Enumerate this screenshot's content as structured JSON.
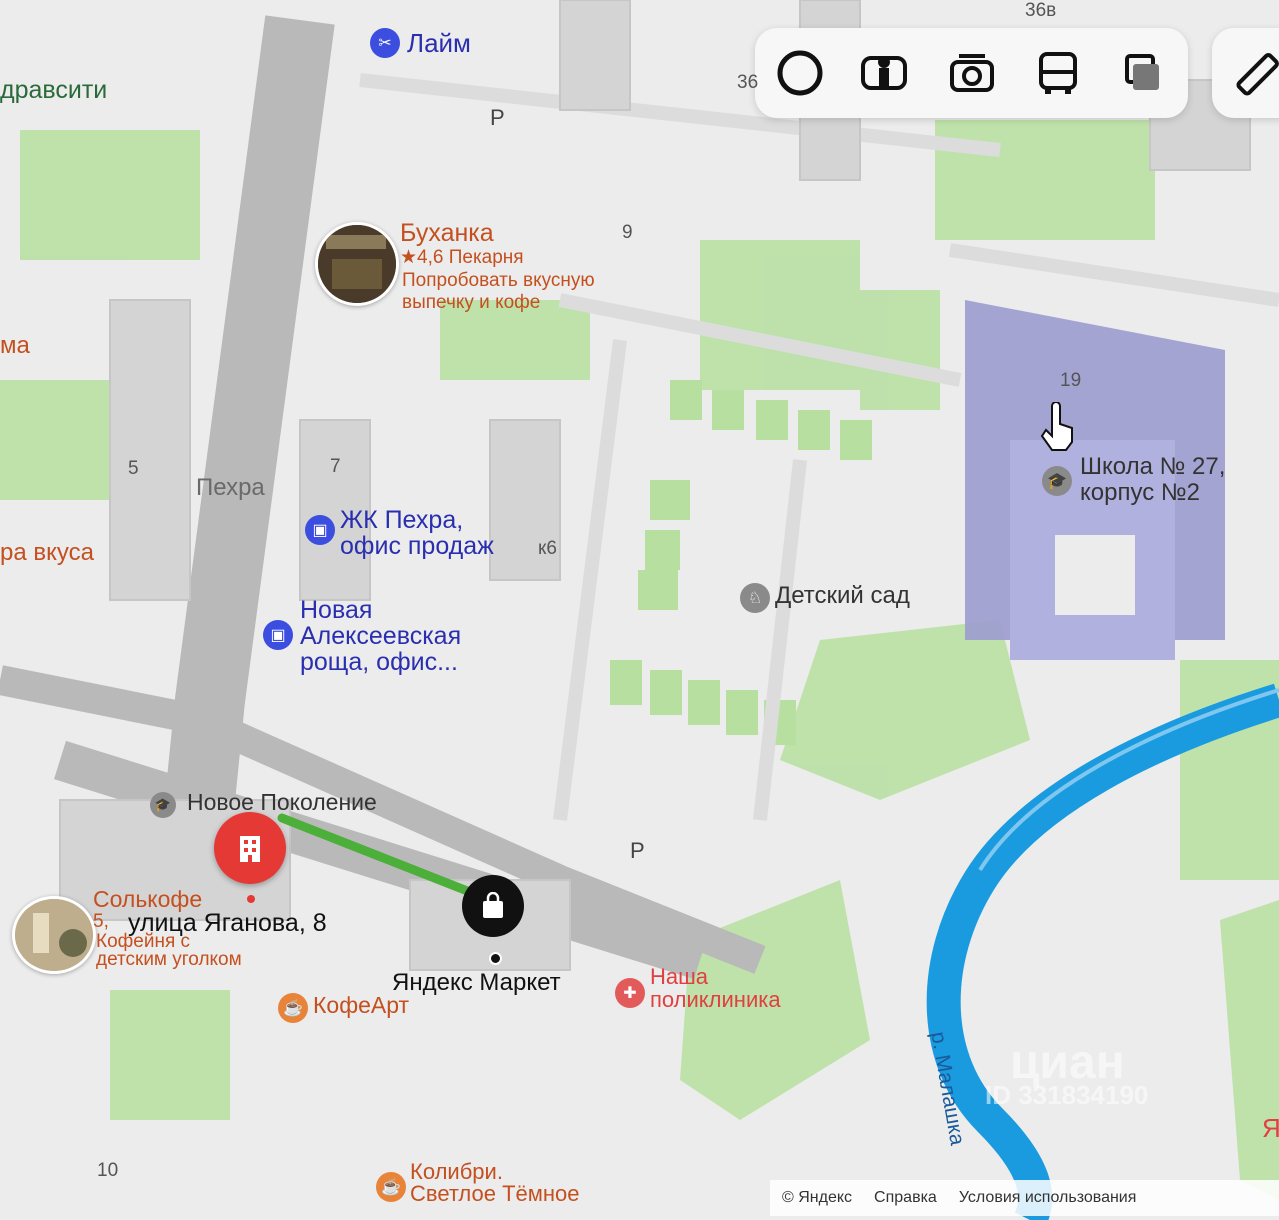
{
  "toolbar": {
    "tools": [
      "circle-icon",
      "panorama-person-icon",
      "camera-icon",
      "bus-icon",
      "layers-icon"
    ],
    "ruler": "ruler-icon"
  },
  "places": {
    "laim": "Лайм",
    "buhanka_name": "Буханка",
    "buhanka_rating": "★4,6 Пекарня",
    "buhanka_desc_1": "Попробовать вкусную",
    "buhanka_desc_2": "выпечку и кофе",
    "pehra": "Пехра",
    "zhk_1": "ЖК Пехра,",
    "zhk_2": "офис продаж",
    "nar_1": "Новая",
    "nar_2": "Алексеевская",
    "nar_3": "роща, офис...",
    "school_1": "Школа № 27,",
    "school_2": "корпус №2",
    "kindergarten": "Детский сад",
    "novoe_pokolenie": "Новое Поколение",
    "address": "улица Яганова, 8",
    "solkofe_1": "Солькофе",
    "solkofe_2": "Кофейня с",
    "solkofe_3": "детским уголком",
    "solkofe_rating": "5,",
    "yandex_market": "Яндекс Маркет",
    "polyclinic_1": "Наша",
    "polyclinic_2": "поликлиника",
    "kofeart": "КофеАрт",
    "kolibri_1": "Колибри.",
    "kolibri_2": "Светлое Тёмное",
    "river": "р. Малашка",
    "edge_top_left": "дравсити",
    "edge_left_1": "ма",
    "edge_left_2": "ра вкуса",
    "edge_right": "Я"
  },
  "numbers": {
    "n36": "36",
    "n36b": "36в",
    "n9": "9",
    "n19": "19",
    "n5": "5",
    "n7": "7",
    "nk6": "к6",
    "n10": "10",
    "p1": "P",
    "p2": "P"
  },
  "footer": {
    "copyright": "© Яндекс",
    "help": "Справка",
    "terms": "Условия использования"
  },
  "watermark": {
    "brand": "циан",
    "id": "ID 331834190"
  },
  "colors": {
    "park": "#b7e0a0",
    "water": "#1a9be0",
    "school_area": "#9c9ccf",
    "road": "#b9b9b9",
    "route": "#4caf3a",
    "pin_red": "#e53935"
  }
}
